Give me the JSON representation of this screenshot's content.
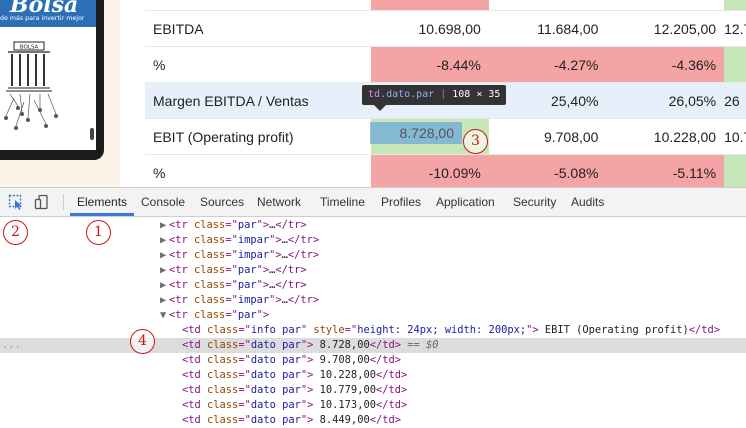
{
  "book": {
    "title": "Bolsa",
    "subtitle": "de más para invertir mejor",
    "sign": "BOLSA"
  },
  "table": {
    "rows": [
      {
        "label": "EBITDA",
        "values": [
          "10.698,00",
          "11.684,00",
          "12.205,00",
          "12.7"
        ],
        "style": "white"
      },
      {
        "label": "%",
        "values": [
          "-8.44%",
          "-4.27%",
          "-4.36%",
          ""
        ],
        "style": "pct"
      },
      {
        "label": "Margen EBITDA / Ventas",
        "values": [
          "",
          "25,40%",
          "26,05%",
          "26"
        ],
        "style": "blue"
      },
      {
        "label": "EBIT (Operating profit)",
        "values": [
          "8.728,00",
          "9.708,00",
          "10.228,00",
          "10.7"
        ],
        "style": "white"
      },
      {
        "label": "%",
        "values": [
          "-10.09%",
          "-5.08%",
          "-5.11%",
          ""
        ],
        "style": "pct"
      }
    ]
  },
  "tooltip": {
    "tag": "td",
    "class": ".dato.par",
    "size": "108 × 35"
  },
  "callouts": {
    "c1": "1",
    "c2": "2",
    "c3": "3",
    "c4": "4"
  },
  "devtools": {
    "tabs": [
      "Elements",
      "Console",
      "Sources",
      "Network",
      "Timeline",
      "Profiles",
      "Application",
      "Security",
      "Audits"
    ],
    "active_tab": "Elements",
    "collapsed_rows": [
      {
        "class": "par"
      },
      {
        "class": "impar"
      },
      {
        "class": "impar"
      },
      {
        "class": "par"
      },
      {
        "class": "par"
      },
      {
        "class": "impar"
      }
    ],
    "expanded_row": {
      "class": "par"
    },
    "info_td": {
      "class": "info par",
      "style": "height: 24px; width: 200px;",
      "text": " EBIT (Operating profit)"
    },
    "dato_tds": [
      {
        "class": "dato par",
        "text": "8.728,00"
      },
      {
        "class": "dato par",
        "text": "9.708,00"
      },
      {
        "class": "dato par",
        "text": "10.228,00"
      },
      {
        "class": "dato par",
        "text": "10.779,00"
      },
      {
        "class": "dato par",
        "text": "10.173,00"
      },
      {
        "class": "dato par",
        "text": "8.449,00"
      }
    ],
    "selected_marker": "== $0",
    "ellipsis": "..."
  }
}
